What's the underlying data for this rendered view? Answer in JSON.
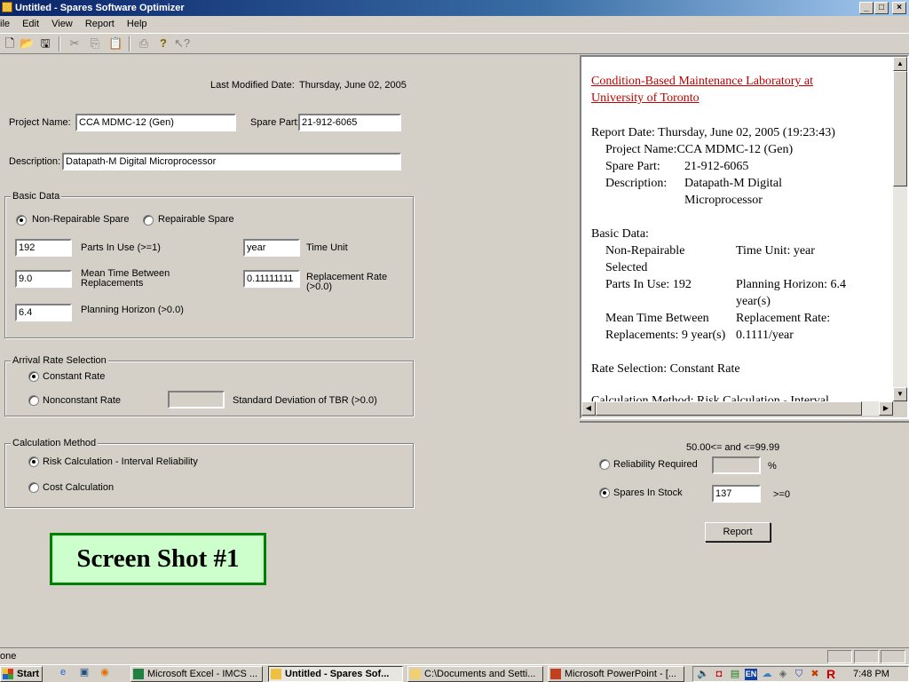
{
  "window": {
    "title": "Untitled - Spares Software Optimizer",
    "minimize": "_",
    "maximize": "□",
    "close": "×"
  },
  "menu": [
    "ile",
    "Edit",
    "View",
    "Report",
    "Help"
  ],
  "toolbar": {
    "icons": [
      "new-file-icon",
      "open-folder-icon",
      "save-icon",
      "cut-icon",
      "copy-icon",
      "paste-icon",
      "print-icon",
      "help-icon",
      "whats-this-help-icon"
    ]
  },
  "form": {
    "last_modified_label": "Last Modified Date:",
    "last_modified_value": "Thursday, June 02, 2005",
    "project_name_label": "Project Name:",
    "project_name_value": "CCA MDMC-12 (Gen)",
    "spare_part_label": "Spare Part:",
    "spare_part_value": "21-912-6065",
    "description_label": "Description:",
    "description_value": "Datapath-M Digital Microprocessor"
  },
  "basic_data": {
    "title": "Basic Data",
    "non_repairable_label": "Non-Repairable Spare",
    "repairable_label": "Repairable Spare",
    "parts_in_use_value": "192",
    "parts_in_use_label": "Parts In Use (>=1)",
    "time_unit_value": "year",
    "time_unit_label": "Time Unit",
    "mtbr_value": "9.0",
    "mtbr_label_1": "Mean Time Between",
    "mtbr_label_2": "Replacements",
    "replacement_rate_value": "0.11111111",
    "replacement_rate_label_1": "Replacement Rate",
    "replacement_rate_label_2": "(>0.0)",
    "planning_horizon_value": "6.4",
    "planning_horizon_label": "Planning Horizon (>0.0)"
  },
  "arrival_rate": {
    "title": "Arrival Rate Selection",
    "constant_label": "Constant Rate",
    "nonconstant_label": "Nonconstant Rate",
    "std_dev_label": "Standard Deviation of TBR (>0.0)"
  },
  "calculation": {
    "title": "Calculation Method",
    "risk_label": "Risk Calculation - Interval Reliability",
    "cost_label": "Cost Calculation"
  },
  "overlay_label": "Screen Shot #1",
  "report": {
    "link_text": "Condition-Based Maintenance Laboratory at University of Toronto",
    "report_date": "Report Date: Thursday, June 02, 2005 (19:23:43)",
    "project_name": "Project Name:CCA MDMC-12 (Gen)",
    "spare_part_label": "Spare Part:",
    "spare_part_value": "21-912-6065",
    "description_label": "Description:",
    "description_value_1": "Datapath-M Digital",
    "description_value_2": "Microprocessor",
    "basic_data": "Basic Data:",
    "non_repairable": "Non-Repairable",
    "selected": "Selected",
    "time_unit": "Time Unit: year",
    "parts_in_use": "Parts In Use: 192",
    "planning_horizon_1": "Planning Horizon: 6.4",
    "planning_horizon_2": "year(s)",
    "mtbr_1": "Mean Time Between",
    "mtbr_2": "Replacements: 9 year(s)",
    "replacement_rate_1": "Replacement Rate:",
    "replacement_rate_2": "0.1111/year",
    "rate_selection": "Rate Selection: Constant Rate",
    "calc_method_partial": "Calculation Method: Risk Calculation - Interval"
  },
  "lower_right": {
    "range_label": "50.00<= and <=99.99",
    "reliability_label": "Reliability Required",
    "percent": "%",
    "spares_label": "Spares In Stock",
    "spares_value": "137",
    "spares_constraint": ">=0",
    "report_button": "Report"
  },
  "status_bar": {
    "text": "one"
  },
  "taskbar": {
    "start": "Start",
    "tasks": [
      "Microsoft Excel - IMCS ...",
      "Untitled - Spares Sof...",
      "C:\\Documents and Setti...",
      "Microsoft PowerPoint - [..."
    ],
    "clock": "7:48 PM",
    "tray_lang": "EN"
  }
}
